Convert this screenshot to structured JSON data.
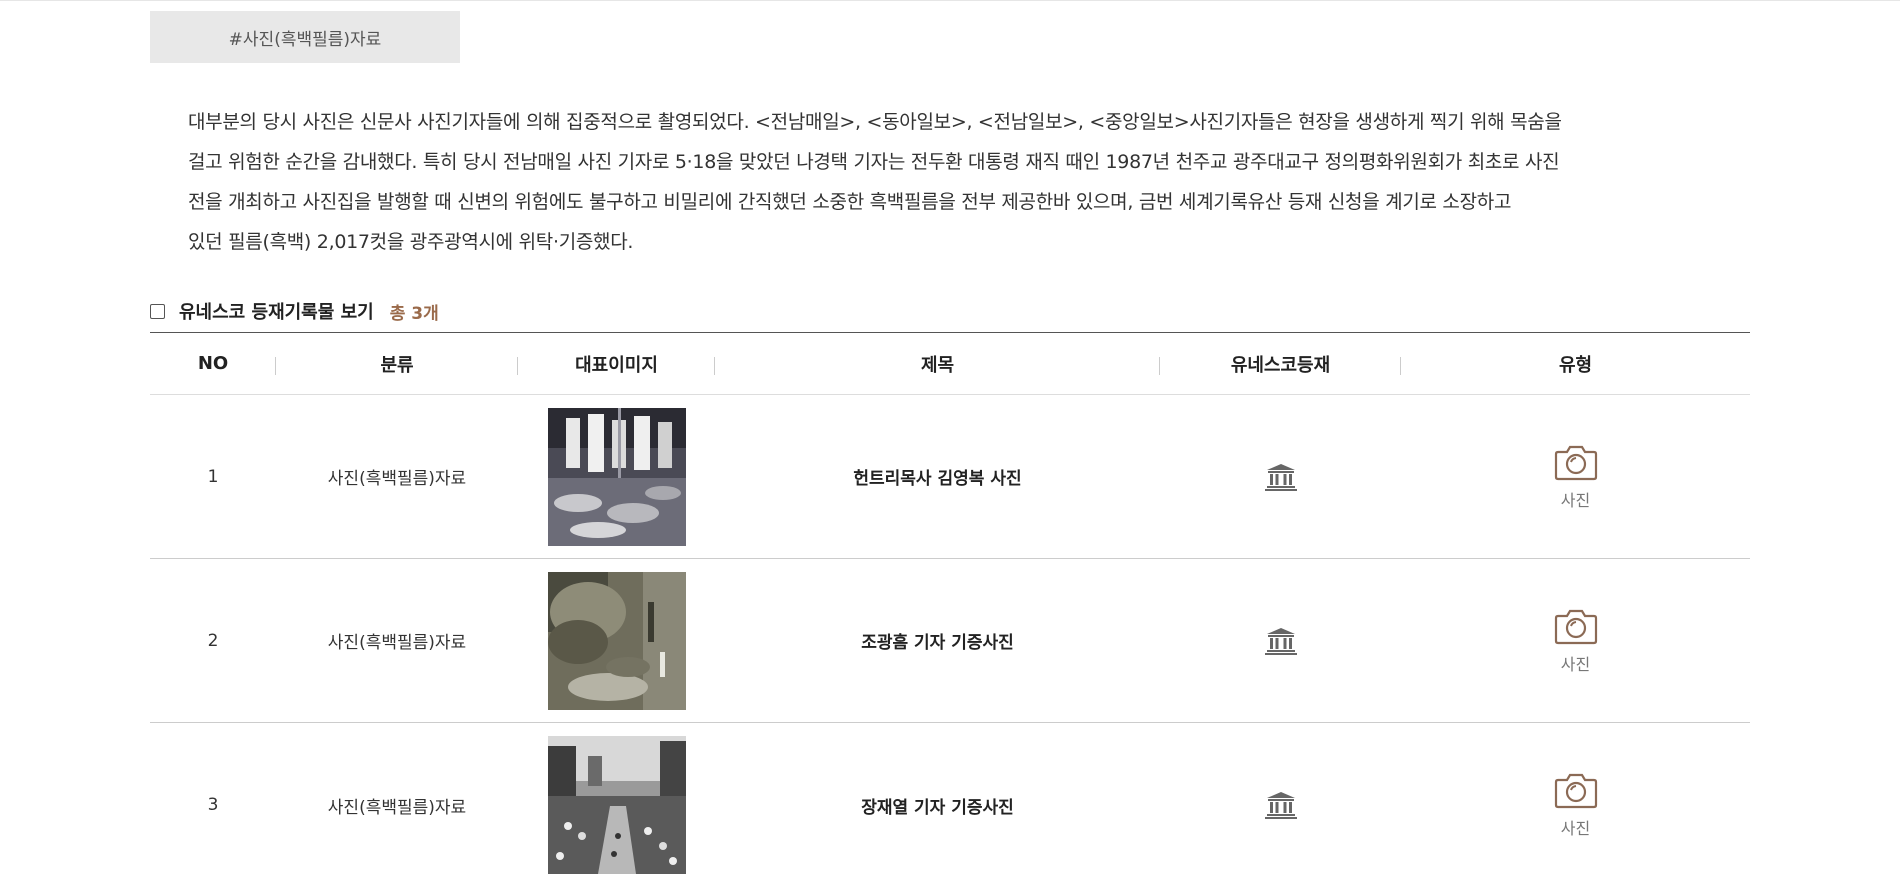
{
  "tag": {
    "label": "#사진(흑백필름)자료"
  },
  "description": {
    "lines": [
      "대부분의 당시 사진은 신문사 사진기자들에 의해 집중적으로 촬영되었다. <전남매일>, <동아일보>, <전남일보>, <중앙일보>사진기자들은 현장을 생생하게 찍기 위해 목숨을",
      "걸고 위험한 순간을 감내했다. 특히 당시 전남매일 사진 기자로 5·18을 맞았던 나경택 기자는 전두환 대통령 재직 때인 1987년 천주교 광주대교구 정의평화위원회가 최초로 사진",
      "전을 개최하고 사진집을 발행할 때 신변의 위험에도 불구하고 비밀리에 간직했던 소중한 흑백필름을 전부 제공한바 있으며, 금번 세계기록유산 등재 신청을 계기로 소장하고",
      "있던 필름(흑백) 2,017컷을 광주광역시에 위탁·기증했다."
    ]
  },
  "filter": {
    "label": "유네스코 등재기록물 보기",
    "count": "총 3개",
    "checked": false
  },
  "table": {
    "headers": {
      "no": "NO",
      "category": "분류",
      "image": "대표이미지",
      "title": "제목",
      "unesco": "유네스코등재",
      "type": "유형"
    },
    "rows": [
      {
        "no": "1",
        "category": "사진(흑백필름)자료",
        "title": "헌트리목사 김영복 사진",
        "unesco_icon": "unesco-heritage-icon",
        "type_icon": "camera-icon",
        "type": "사진"
      },
      {
        "no": "2",
        "category": "사진(흑백필름)자료",
        "title": "조광흠 기자 기증사진",
        "unesco_icon": "unesco-heritage-icon",
        "type_icon": "camera-icon",
        "type": "사진"
      },
      {
        "no": "3",
        "category": "사진(흑백필름)자료",
        "title": "장재열 기자 기증사진",
        "unesco_icon": "unesco-heritage-icon",
        "type_icon": "camera-icon",
        "type": "사진"
      }
    ]
  },
  "colors": {
    "accent": "#9a6a4a",
    "icon": "#8b6a55",
    "tag_bg": "#e8e8e8"
  }
}
